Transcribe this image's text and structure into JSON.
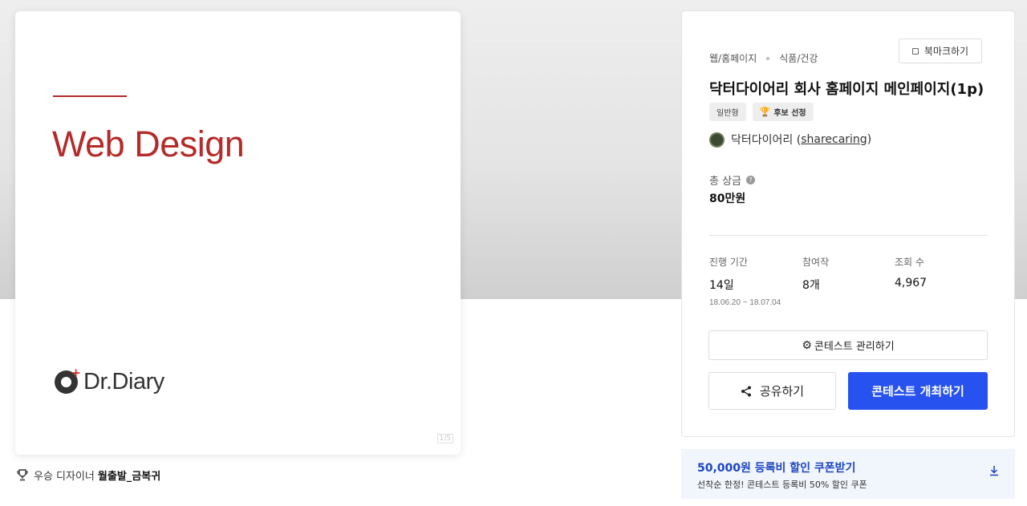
{
  "preview": {
    "headline": "Web Design",
    "brand_name": "Dr.Diary",
    "page_indicator": "1/5"
  },
  "winner": {
    "label": "우승 디자이너",
    "name": "월출발_금복귀"
  },
  "contest": {
    "category_main": "웹/홈페이지",
    "category_sub": "식품/건강",
    "bookmark_label": "북마크하기",
    "title": "닥터다이어리 회사 홈페이지 메인페이지(1p)",
    "tags": [
      "일반형",
      "후보 선정"
    ],
    "host_name": "닥터다이어리 (",
    "host_handle": "sharecaring",
    "host_close": ")",
    "prize_label": "총 상금",
    "prize_value": "80만원",
    "stats": {
      "period_label": "진행 기간",
      "period_value": "14일",
      "period_dates": "18.06.20 ~ 18.07.04",
      "entries_label": "참여작",
      "entries_value": "8개",
      "views_label": "조회 수",
      "views_value": "4,967"
    },
    "manage_label": "콘테스트 관리하기",
    "share_label": "공유하기",
    "host_contest_label": "콘테스트 개최하기"
  },
  "coupon": {
    "title": "50,000원 등록비 할인 쿠폰받기",
    "subtitle": "선착순 한정! 콘테스트 등록비 50% 할인 쿠폰"
  },
  "colors": {
    "accent_red": "#b52a2a",
    "primary_blue": "#2752f0",
    "coupon_bg": "#f1f5fc"
  },
  "icons": [
    "trophy-icon",
    "bookmark-icon",
    "help-icon",
    "gear-icon",
    "share-icon",
    "download-icon"
  ]
}
